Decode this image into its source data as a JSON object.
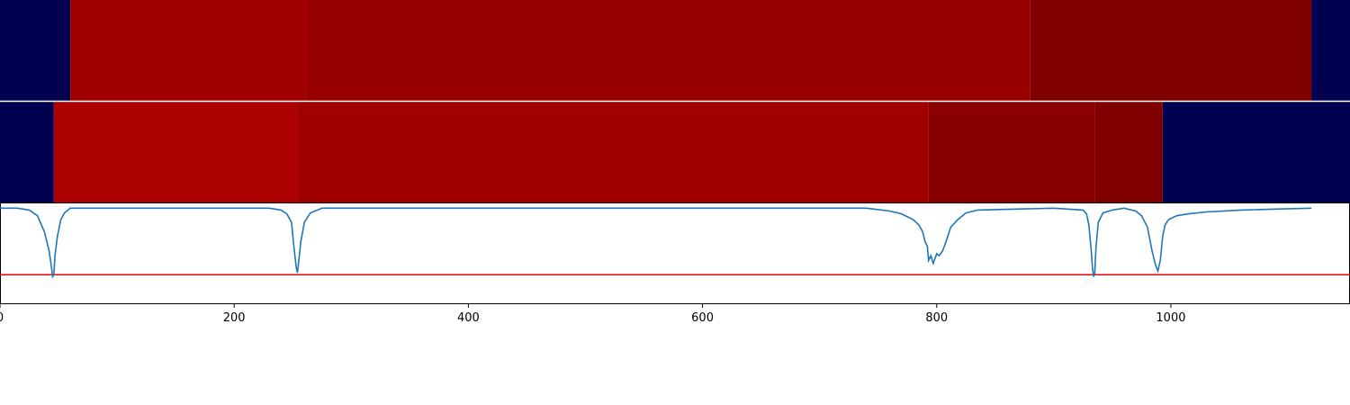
{
  "chart_data": {
    "type": "heatmap",
    "xlim": [
      0,
      1153
    ],
    "x_ticks": [
      {
        "value": 0,
        "label": "0"
      },
      {
        "value": 200,
        "label": "200"
      },
      {
        "value": 400,
        "label": "400"
      },
      {
        "value": 600,
        "label": "600"
      },
      {
        "value": 800,
        "label": "800"
      },
      {
        "value": 1000,
        "label": "1000"
      }
    ],
    "segment_rows": [
      {
        "segments": [
          {
            "start": 0,
            "end": 60,
            "color": "#000050"
          },
          {
            "start": 60,
            "end": 261,
            "color": "#a00000"
          },
          {
            "start": 261,
            "end": 880,
            "color": "#990000"
          },
          {
            "start": 880,
            "end": 1120,
            "color": "#800000"
          },
          {
            "start": 1120,
            "end": 1153,
            "color": "#000050"
          }
        ]
      },
      {
        "segments": [
          {
            "start": 0,
            "end": 46,
            "color": "#000050"
          },
          {
            "start": 46,
            "end": 254,
            "color": "#ad0000"
          },
          {
            "start": 254,
            "end": 793,
            "color": "#a00000"
          },
          {
            "start": 793,
            "end": 935,
            "color": "#880000"
          },
          {
            "start": 935,
            "end": 993,
            "color": "#800000"
          },
          {
            "start": 993,
            "end": 1153,
            "color": "#000050"
          }
        ]
      }
    ],
    "signal": {
      "color": "#1f77b4",
      "ylim": [
        -1.0,
        0.05
      ],
      "x": [
        0,
        15,
        25,
        32,
        38,
        42,
        44,
        45,
        46,
        47,
        49,
        52,
        55,
        60,
        70,
        230,
        240,
        245,
        249,
        251,
        253,
        254,
        255,
        257,
        260,
        265,
        275,
        740,
        760,
        770,
        780,
        785,
        788,
        790,
        792,
        793,
        795,
        797,
        800,
        802,
        805,
        808,
        812,
        818,
        825,
        835,
        900,
        925,
        928,
        930,
        932,
        933,
        934,
        935,
        936,
        938,
        942,
        950,
        960,
        970,
        975,
        980,
        984,
        987,
        989,
        991,
        993,
        995,
        998,
        1005,
        1015,
        1030,
        1060,
        1090,
        1120
      ],
      "y": [
        0,
        0,
        -0.02,
        -0.08,
        -0.25,
        -0.45,
        -0.62,
        -0.72,
        -0.7,
        -0.5,
        -0.3,
        -0.12,
        -0.05,
        0,
        0,
        0,
        -0.02,
        -0.06,
        -0.15,
        -0.4,
        -0.62,
        -0.68,
        -0.58,
        -0.35,
        -0.15,
        -0.05,
        0,
        0,
        -0.03,
        -0.06,
        -0.12,
        -0.18,
        -0.25,
        -0.35,
        -0.4,
        -0.55,
        -0.5,
        -0.58,
        -0.48,
        -0.5,
        -0.45,
        -0.35,
        -0.2,
        -0.12,
        -0.05,
        -0.02,
        0,
        -0.02,
        -0.06,
        -0.18,
        -0.45,
        -0.62,
        -0.72,
        -0.68,
        -0.42,
        -0.15,
        -0.05,
        -0.02,
        0,
        -0.03,
        -0.08,
        -0.2,
        -0.45,
        -0.6,
        -0.66,
        -0.55,
        -0.3,
        -0.18,
        -0.12,
        -0.08,
        -0.06,
        -0.04,
        -0.02,
        -0.01,
        0
      ]
    },
    "threshold": {
      "value": -0.7,
      "color": "#ff0000"
    },
    "grid": false
  }
}
